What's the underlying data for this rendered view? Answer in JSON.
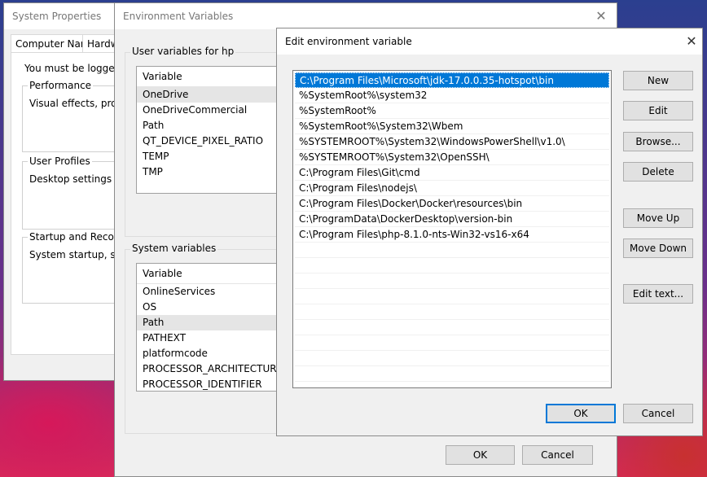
{
  "system_properties": {
    "title": "System Properties",
    "tabs": [
      "Computer Name",
      "Hardwa"
    ],
    "logged_on_note": "You must be logged on",
    "performance": {
      "label": "Performance",
      "desc": "Visual effects, process"
    },
    "user_profiles": {
      "label": "User Profiles",
      "desc": "Desktop settings relate"
    },
    "startup": {
      "label": "Startup and Recovery",
      "desc": "System startup, system"
    }
  },
  "env_vars": {
    "title": "Environment Variables",
    "close_glyph": "✕",
    "user_section_label": "User variables for hp",
    "user_header": "Variable",
    "user_vars": [
      "OneDrive",
      "OneDriveCommercial",
      "Path",
      "QT_DEVICE_PIXEL_RATIO",
      "TEMP",
      "TMP"
    ],
    "system_section_label": "System variables",
    "system_header": "Variable",
    "system_vars": [
      "OnlineServices",
      "OS",
      "Path",
      "PATHEXT",
      "platformcode",
      "PROCESSOR_ARCHITECTURE",
      "PROCESSOR_IDENTIFIER"
    ],
    "ok_label": "OK",
    "cancel_label": "Cancel"
  },
  "edit_env": {
    "title": "Edit environment variable",
    "close_glyph": "✕",
    "paths": [
      "C:\\Program Files\\Microsoft\\jdk-17.0.0.35-hotspot\\bin",
      "%SystemRoot%\\system32",
      "%SystemRoot%",
      "%SystemRoot%\\System32\\Wbem",
      "%SYSTEMROOT%\\System32\\WindowsPowerShell\\v1.0\\",
      "%SYSTEMROOT%\\System32\\OpenSSH\\",
      "C:\\Program Files\\Git\\cmd",
      "C:\\Program Files\\nodejs\\",
      "C:\\Program Files\\Docker\\Docker\\resources\\bin",
      "C:\\ProgramData\\DockerDesktop\\version-bin",
      "C:\\Program Files\\php-8.1.0-nts-Win32-vs16-x64"
    ],
    "buttons": {
      "new": "New",
      "edit": "Edit",
      "browse": "Browse...",
      "delete": "Delete",
      "move_up": "Move Up",
      "move_down": "Move Down",
      "edit_text": "Edit text..."
    },
    "ok_label": "OK",
    "cancel_label": "Cancel"
  }
}
